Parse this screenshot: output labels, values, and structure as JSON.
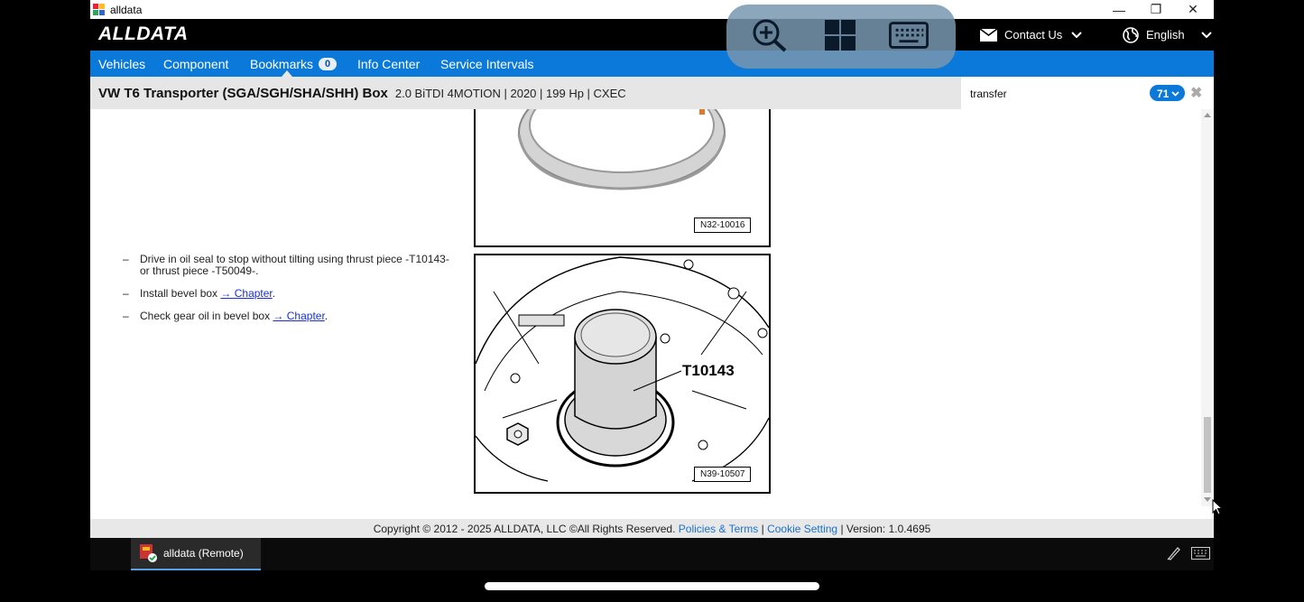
{
  "window": {
    "title": "alldata",
    "minimize": "—",
    "restore": "❐",
    "close": "✕"
  },
  "header": {
    "logo": "ALLDATA",
    "contact": "Contact Us",
    "language": "English"
  },
  "remote_toolbar": {
    "icons": [
      "zoom-in-icon",
      "grid-icon",
      "keyboard-icon"
    ]
  },
  "nav": {
    "items": [
      {
        "label": "Vehicles"
      },
      {
        "label": "Component"
      },
      {
        "label": "Bookmarks"
      },
      {
        "label": "Info Center"
      },
      {
        "label": "Service Intervals"
      }
    ],
    "bookmarks_count": "0",
    "active": "Component"
  },
  "vehicle": {
    "name": "VW T6 Transporter (SGA/SGH/SHA/SHH) Box",
    "spec": "2.0 BiTDI 4MOTION | 2020 | 199 Hp | CXEC"
  },
  "search": {
    "query": "transfer",
    "count": "71"
  },
  "content": {
    "steps": [
      {
        "dash": "–",
        "text": "Drive in oil seal to stop without tilting using thrust piece -T10143- or thrust piece -T50049-.",
        "link": ""
      },
      {
        "dash": "–",
        "text": "Install bevel box ",
        "link": "→ Chapter",
        "after": "."
      },
      {
        "dash": "–",
        "text": "Check gear oil in bevel box ",
        "link": "→ Chapter",
        "after": "."
      }
    ],
    "figures": [
      {
        "label": "N32-10016"
      },
      {
        "label": "N39-10507",
        "callout": "T10143"
      }
    ]
  },
  "footer": {
    "copyright": "Copyright © 2012 - 2025 ALLDATA, LLC ©All Rights Reserved.",
    "policies": "Policies & Terms",
    "sep": "|",
    "cookie": "Cookie Setting",
    "version": "| Version: 1.0.4695"
  },
  "taskbar": {
    "item": "alldata (Remote)"
  },
  "colors": {
    "nav_blue": "#0a79d9",
    "header_black": "#000000",
    "link_blue": "#1a2fd6"
  }
}
